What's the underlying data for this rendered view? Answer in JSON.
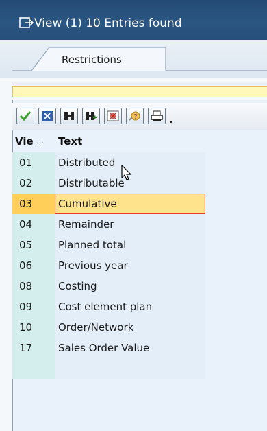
{
  "window": {
    "title": "View (1)   10 Entries found"
  },
  "tabs": [
    {
      "label": "Restrictions",
      "active": true
    }
  ],
  "toolbar": {
    "buttons": [
      {
        "icon": "check-icon"
      },
      {
        "icon": "cancel-icon"
      },
      {
        "icon": "find-icon"
      },
      {
        "icon": "find-next-icon"
      },
      {
        "icon": "multiple-selection-icon"
      },
      {
        "icon": "help-icon"
      },
      {
        "icon": "print-icon"
      }
    ]
  },
  "table": {
    "columns": [
      {
        "label": "Vie"
      },
      {
        "label": "Text"
      }
    ],
    "rows": [
      {
        "code": "01",
        "text": "Distributed"
      },
      {
        "code": "02",
        "text": "Distributable"
      },
      {
        "code": "03",
        "text": "Cumulative",
        "selected": true
      },
      {
        "code": "04",
        "text": "Remainder"
      },
      {
        "code": "05",
        "text": "Planned total"
      },
      {
        "code": "06",
        "text": "Previous year"
      },
      {
        "code": "08",
        "text": "Costing"
      },
      {
        "code": "09",
        "text": "Cost element plan"
      },
      {
        "code": "10",
        "text": "Order/Network"
      },
      {
        "code": "17",
        "text": "Sales Order Value"
      }
    ]
  },
  "colors": {
    "titlebar": "#2b5683",
    "selected_row": "#ffe38c",
    "selected_border": "#e63a2a",
    "code_column": "#d4eeee",
    "text_column": "#e3eef8"
  }
}
